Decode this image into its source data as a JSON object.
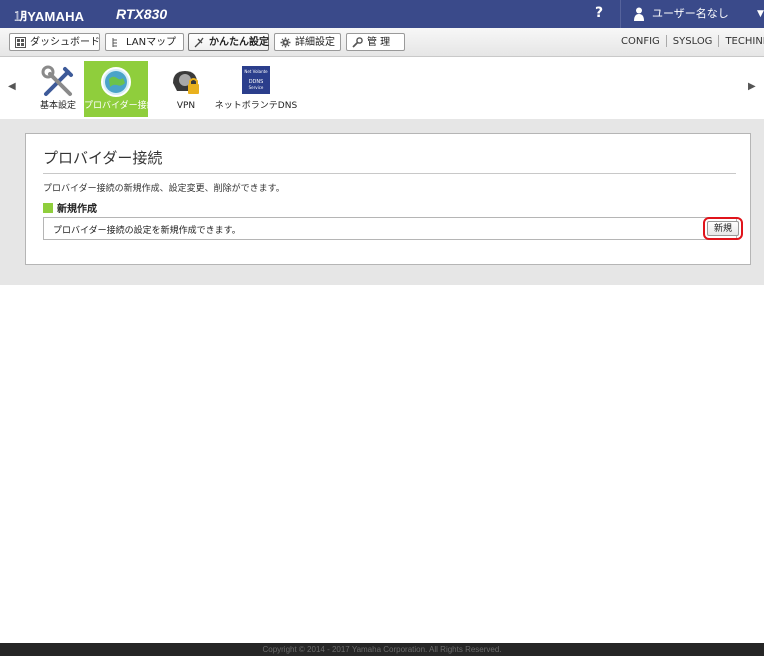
{
  "header": {
    "brand": "㋀YAMAHA",
    "model": "RTX830",
    "help": "?",
    "user": "ユーザー名なし",
    "caret": "▼"
  },
  "tabs": [
    {
      "label": "ダッシュボード",
      "icon": "dashboard-icon"
    },
    {
      "label": "LANマップ",
      "icon": "lan-map-icon"
    },
    {
      "label": "かんたん設定",
      "icon": "easy-setup-icon",
      "active": true
    },
    {
      "label": "詳細設定",
      "icon": "gear-icon"
    },
    {
      "label": "管 理",
      "icon": "wrench-icon"
    }
  ],
  "links": [
    "CONFIG",
    "SYSLOG",
    "TECHINFO"
  ],
  "features": [
    {
      "label": "基本設定",
      "icon": "tools-icon"
    },
    {
      "label": "プロバイダー接続",
      "icon": "globe-icon",
      "active": true
    },
    {
      "label": "VPN",
      "icon": "vpn-lock-icon"
    },
    {
      "label": "ネットボランテDNS",
      "icon": "ddns-icon"
    }
  ],
  "ddns_badge": {
    "top": "Net Volante",
    "mid": "DDNS",
    "bottom": "Service"
  },
  "nav": {
    "prev": "◀",
    "next": "▶"
  },
  "panel": {
    "title": "プロバイダー接続",
    "description": "プロバイダー接続の新規作成、設定変更、削除ができます。",
    "section_title": "新規作成",
    "row_text": "プロバイダー接続の設定を新規作成できます。",
    "new_button": "新規"
  },
  "footer": "Copyright © 2014 - 2017 Yamaha Corporation. All Rights Reserved.",
  "colors": {
    "header_bg": "#3a4a8a",
    "accent_green": "#8fce3c",
    "highlight_red": "#e0141b"
  }
}
